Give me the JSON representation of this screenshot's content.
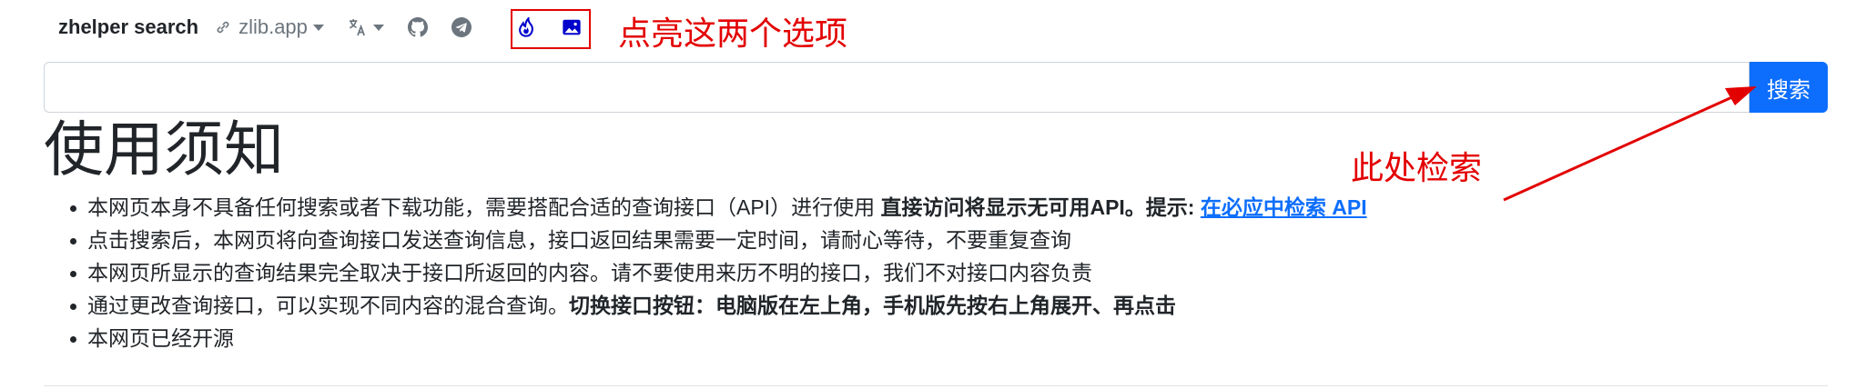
{
  "nav": {
    "brand": "zhelper search",
    "source_label": "zlib.app",
    "icons": [
      "link-icon",
      "translate-icon",
      "github-icon",
      "telegram-icon",
      "fire-icon",
      "image-icon"
    ]
  },
  "annotations": {
    "highlight_note": "点亮这两个选项",
    "search_note": "此处检索",
    "color": "#e30000"
  },
  "search": {
    "value": "",
    "button_label": "搜索"
  },
  "main": {
    "title": "使用须知",
    "notes": [
      {
        "text": "本网页本身不具备任何搜索或者下载功能，需要搭配合适的查询接口（API）进行使用 ",
        "bold": "直接访问将显示无可用API。提示: ",
        "link": "在必应中检索 API"
      },
      {
        "text": "点击搜索后，本网页将向查询接口发送查询信息，接口返回结果需要一定时间，请耐心等待，不要重复查询"
      },
      {
        "text": "本网页所显示的查询结果完全取决于接口所返回的内容。请不要使用来历不明的接口，我们不对接口内容负责"
      },
      {
        "text": "通过更改查询接口，可以实现不同内容的混合查询。",
        "bold": "切换接口按钮：电脑版在左上角，手机版先按右上角展开、再点击"
      },
      {
        "text": "本网页已经开源"
      }
    ]
  },
  "colors": {
    "primary": "#0d6efd",
    "text": "#212529",
    "muted": "#6c757d",
    "highlight_icons": "#0000cc"
  }
}
